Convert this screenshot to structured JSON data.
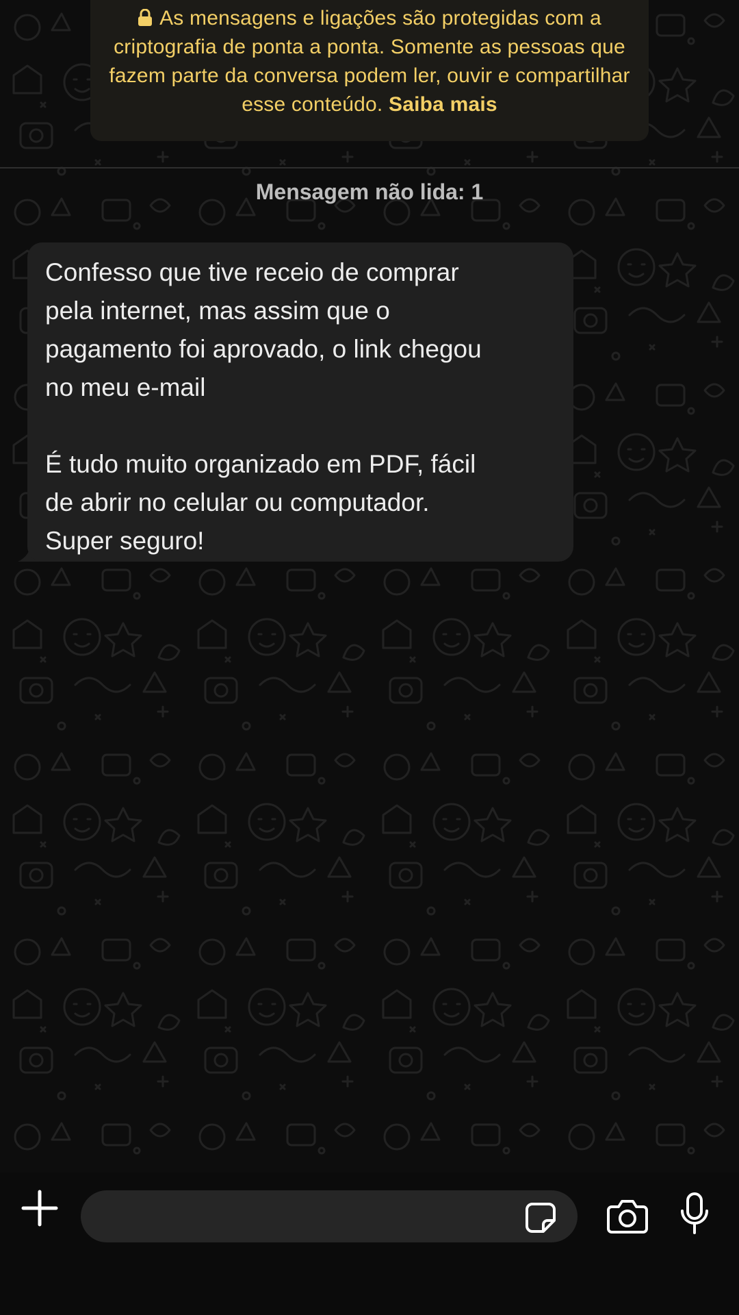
{
  "encryption_notice": {
    "text": "As mensagens e ligações são protegidas com a criptografia de ponta a ponta. Somente as pessoas que fazem parte da conversa podem ler, ouvir e compartilhar esse conteúdo.",
    "link": "Saiba mais",
    "color": "#f3cf66"
  },
  "unread": {
    "label": "Mensagem não lida: 1"
  },
  "message": {
    "paragraphs": [
      "Confesso que tive receio de comprar\npela internet, mas assim que o\npagamento foi aprovado, o link chegou\nno meu e-mail",
      "É tudo muito organizado em PDF, fácil\nde abrir no celular ou computador.\nSuper seguro!"
    ]
  },
  "composer": {
    "placeholder": "",
    "icons": [
      "plus-icon",
      "sticker-icon",
      "camera-icon",
      "mic-icon"
    ]
  },
  "colors": {
    "background": "#0d0d0d",
    "bubble": "#202020",
    "doodle": "#1f1f1f"
  }
}
